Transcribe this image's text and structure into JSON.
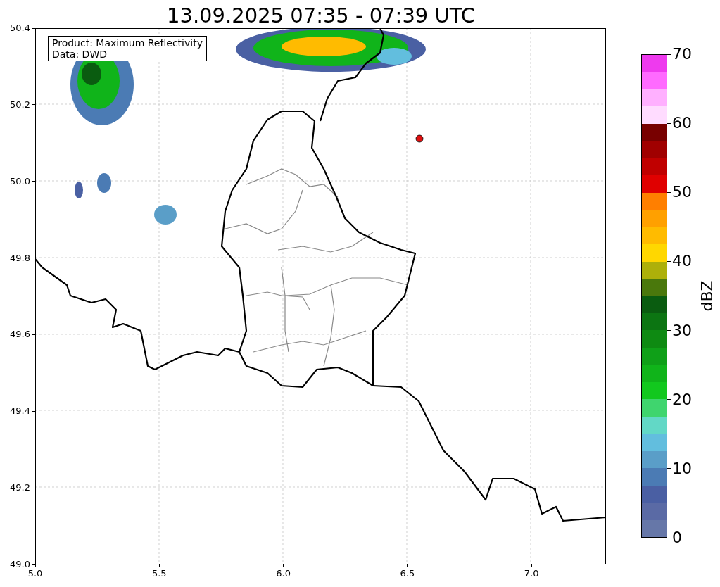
{
  "title": "13.09.2025 07:35 - 07:39 UTC",
  "annotation": {
    "lines": [
      "Product: Maximum Reflectivity",
      "Data: DWD"
    ]
  },
  "x_ticks": [
    "5.0",
    "5.5",
    "6.0",
    "6.5",
    "7.0"
  ],
  "y_ticks": [
    "50.4",
    "50.2",
    "50.0",
    "49.8",
    "49.6",
    "49.4",
    "49.2",
    "49.0"
  ],
  "colorbar": {
    "label": "dBZ",
    "ticks": [
      "70",
      "60",
      "50",
      "40",
      "30",
      "20",
      "10",
      "0"
    ],
    "segments": [
      {
        "color": "#6677a8"
      },
      {
        "color": "#5a6aa5"
      },
      {
        "color": "#4a5fa3"
      },
      {
        "color": "#4b7bb4"
      },
      {
        "color": "#5a9ec8"
      },
      {
        "color": "#62bede"
      },
      {
        "color": "#62d8c6"
      },
      {
        "color": "#3fd56e"
      },
      {
        "color": "#12c81e"
      },
      {
        "color": "#10b41a"
      },
      {
        "color": "#0fa018"
      },
      {
        "color": "#0e8a12"
      },
      {
        "color": "#0c7512"
      },
      {
        "color": "#0a5c10"
      },
      {
        "color": "#4a780c"
      },
      {
        "color": "#adb00a"
      },
      {
        "color": "#ffd700"
      },
      {
        "color": "#ffbb00"
      },
      {
        "color": "#ffa000"
      },
      {
        "color": "#ff7f00"
      },
      {
        "color": "#e00000"
      },
      {
        "color": "#c00000"
      },
      {
        "color": "#a00000"
      },
      {
        "color": "#780000"
      },
      {
        "color": "#ffdcff"
      },
      {
        "color": "#ffb0ff"
      },
      {
        "color": "#ff6aff"
      },
      {
        "color": "#ee3aee"
      }
    ]
  }
}
